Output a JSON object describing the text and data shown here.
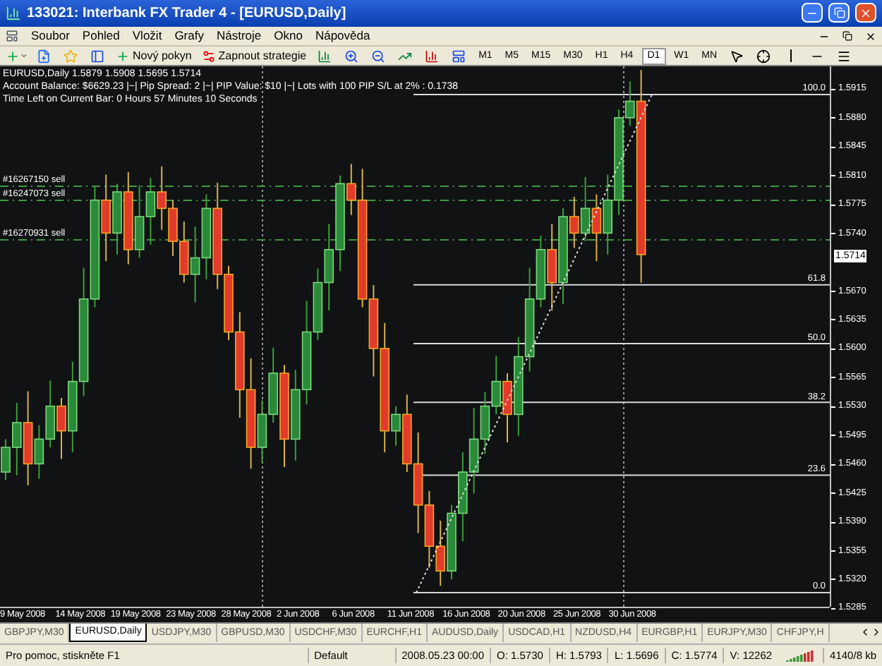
{
  "window": {
    "title": "133021: Interbank FX Trader 4 - [EURUSD,Daily]"
  },
  "menu": [
    "Soubor",
    "Pohled",
    "Vložit",
    "Grafy",
    "Nástroje",
    "Okno",
    "Nápověda"
  ],
  "toolbar": {
    "buttons": [
      {
        "label": "Nový pokyn"
      },
      {
        "label": "Zapnout strategie"
      }
    ],
    "timeframes": [
      {
        "label": "M1",
        "selected": false
      },
      {
        "label": "M5",
        "selected": false
      },
      {
        "label": "M15",
        "selected": false
      },
      {
        "label": "M30",
        "selected": false
      },
      {
        "label": "H1",
        "selected": false
      },
      {
        "label": "H4",
        "selected": false
      },
      {
        "label": "D1",
        "selected": true
      },
      {
        "label": "W1",
        "selected": false
      },
      {
        "label": "MN",
        "selected": false
      }
    ]
  },
  "chart": {
    "info": [
      "EURUSD,Daily  1.5879 1.5908 1.5695 1.5714",
      "Account Balance: $6629.23 |~| Pip Spread: 2 |~| PIP Value: $10 |~| Lots with 100 PIP S/L at 2% : 0.1738",
      "Time Left on Current Bar: 0 Hours 57 Minutes 10 Seconds"
    ],
    "orders": [
      {
        "label": "#16267150 sell"
      },
      {
        "label": "#16247073 sell"
      },
      {
        "label": "#16270931 sell"
      }
    ],
    "fib_levels": [
      "100.0",
      "61.8",
      "50.0",
      "38.2",
      "23.6",
      "0.0"
    ],
    "price_axis": [
      "1.5915",
      "1.5880",
      "1.5845",
      "1.5810",
      "1.5775",
      "1.5740",
      "1.5670",
      "1.5635",
      "1.5600",
      "1.5565",
      "1.5530",
      "1.5495",
      "1.5460",
      "1.5425",
      "1.5390",
      "1.5355",
      "1.5320",
      "1.5285"
    ],
    "current_price": "1.5714",
    "date_axis": [
      "9 May 2008",
      "14 May 2008",
      "19 May 2008",
      "23 May 2008",
      "28 May 2008",
      "2 Jun 2008",
      "6 Jun 2008",
      "11 Jun 2008",
      "16 Jun 2008",
      "20 Jun 2008",
      "25 Jun 2008",
      "30 Jun 2008"
    ]
  },
  "tabs": [
    {
      "label": "GBPJPY,M30",
      "selected": false
    },
    {
      "label": "EURUSD,Daily",
      "selected": true
    },
    {
      "label": "USDJPY,M30",
      "selected": false
    },
    {
      "label": "GBPUSD,M30",
      "selected": false
    },
    {
      "label": "USDCHF,M30",
      "selected": false
    },
    {
      "label": "EURCHF,H1",
      "selected": false
    },
    {
      "label": "AUDUSD,Daily",
      "selected": false
    },
    {
      "label": "USDCAD,H1",
      "selected": false
    },
    {
      "label": "NZDUSD,H4",
      "selected": false
    },
    {
      "label": "EURGBP,H1",
      "selected": false
    },
    {
      "label": "EURJPY,M30",
      "selected": false
    },
    {
      "label": "CHFJPY,H",
      "selected": false
    }
  ],
  "status_bar": {
    "help": "Pro pomoc, stiskněte F1",
    "profile": "Default",
    "time": "2008.05.23 00:00",
    "open": "O: 1.5730",
    "high": "H: 1.5793",
    "low": "L: 1.5696",
    "close": "C: 1.5774",
    "volume": "V: 12262",
    "traffic": "4140/8 kb"
  }
}
